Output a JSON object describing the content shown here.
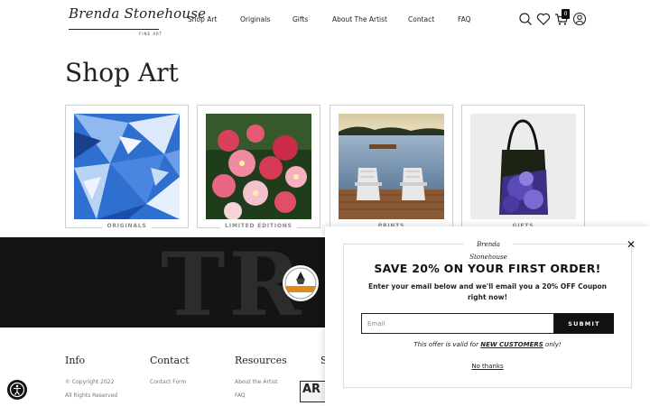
{
  "brand": {
    "logo_script": "Brenda Stonehouse",
    "logo_sub": "FINE ART"
  },
  "nav": {
    "items": [
      "Shop Art",
      "Originals",
      "Gifts",
      "About The Artist",
      "Contact",
      "FAQ"
    ]
  },
  "header_icons": [
    "search-icon",
    "heart-icon",
    "cart-icon",
    "account-icon"
  ],
  "cart": {
    "count": "0"
  },
  "page": {
    "title": "Shop Art"
  },
  "categories": [
    {
      "label": "ORIGINALS",
      "art": "blue-hydrangea"
    },
    {
      "label": "LIMITED EDITIONS",
      "art": "pink-blossoms"
    },
    {
      "label": "PRINTS",
      "art": "lake-dock-chairs"
    },
    {
      "label": "GIFTS",
      "art": "tote-bag"
    }
  ],
  "band": {
    "big_text": "TR"
  },
  "footer": {
    "info": {
      "heading": "Info",
      "links": [
        "© Copyright 2022",
        "All Rights Reserved"
      ]
    },
    "contact": {
      "heading": "Contact",
      "links": [
        "Contact Form"
      ]
    },
    "resources": {
      "heading": "Resources",
      "links": [
        "About the Artist",
        "FAQ"
      ]
    },
    "fourth": {
      "heading": "S"
    },
    "arc_logo": "AR"
  },
  "popup": {
    "logo": "Brenda Stonehouse",
    "close": "✕",
    "headline": "SAVE 20% ON YOUR FIRST ORDER!",
    "body": "Enter your email below and we'll email you a 20% OFF Coupon right now!",
    "email_placeholder": "Email",
    "submit_label": "SUBMIT",
    "offer_prefix": "This offer is valid for ",
    "offer_highlight": "NEW CUSTOMERS",
    "offer_suffix": " only!",
    "no_thanks": "No thanks"
  },
  "colors": {
    "dark": "#141414",
    "accent": "#111111"
  }
}
